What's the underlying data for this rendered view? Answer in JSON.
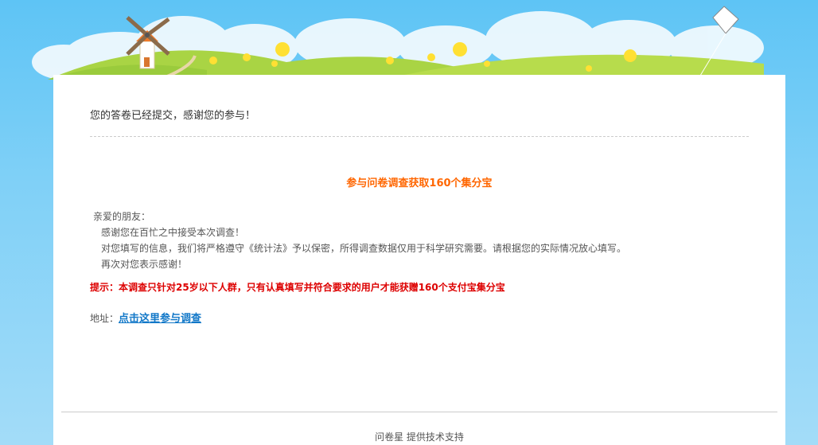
{
  "confirmation": {
    "message": "您的答卷已经提交，感谢您的参与！"
  },
  "promo": {
    "title": "参与问卷调查获取160个集分宝"
  },
  "letter": {
    "greeting": "亲爱的朋友：",
    "line1": "感谢您在百忙之中接受本次调查！",
    "line2": "对您填写的信息，我们将严格遵守《统计法》予以保密，所得调查数据仅用于科学研究需要。请根据您的实际情况放心填写。",
    "line3": "再次对您表示感谢！"
  },
  "tip": {
    "text": "提示：本调查只针对25岁以下人群，只有认真填写并符合要求的用户才能获赠160个支付宝集分宝"
  },
  "address": {
    "label": "地址：",
    "link_text": "点击这里参与调查"
  },
  "footer": {
    "brand": "问卷星",
    "text": " 提供技术支持"
  },
  "colors": {
    "sky": "#5ec4f5",
    "promo_orange": "#ff6600",
    "tip_red": "#dd0000",
    "link_blue": "#1278c8"
  },
  "icons": [
    "windmill-icon",
    "kite-icon",
    "flower-icon"
  ]
}
